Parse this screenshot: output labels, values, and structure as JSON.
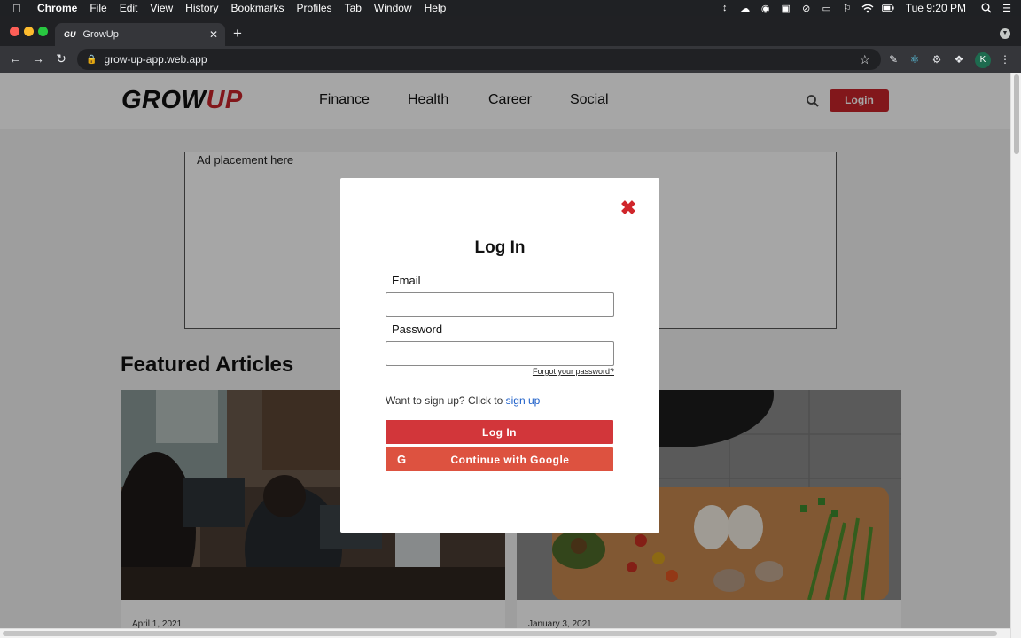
{
  "menubar": {
    "app_name": "Chrome",
    "items": [
      "File",
      "Edit",
      "View",
      "History",
      "Bookmarks",
      "Profiles",
      "Tab",
      "Window",
      "Help"
    ],
    "clock": "Tue 9:20 PM"
  },
  "browser": {
    "tab_title": "GrowUp",
    "tab_favicon": "GU",
    "url": "grow-up-app.web.app",
    "profile_initial": "K"
  },
  "site": {
    "logo_part1": "GROW",
    "logo_part2": "UP",
    "nav": [
      "Finance",
      "Health",
      "Career",
      "Social"
    ],
    "login_button": "Login",
    "ad_text": "Ad placement here",
    "featured_title": "Featured Articles",
    "cards": [
      {
        "date": "April 1, 2021"
      },
      {
        "date": "January 3, 2021"
      }
    ]
  },
  "modal": {
    "title": "Log In",
    "email_label": "Email",
    "email_value": "",
    "password_label": "Password",
    "password_value": "",
    "forgot_link": "Forgot your password?",
    "signup_prompt": "Want to sign up? Click to ",
    "signup_link": "sign up",
    "login_button": "Log In",
    "google_button": "Continue with Google"
  },
  "colors": {
    "brand_red": "#c8242a",
    "google_button": "#dd5240",
    "link_blue": "#1a5dc8"
  }
}
